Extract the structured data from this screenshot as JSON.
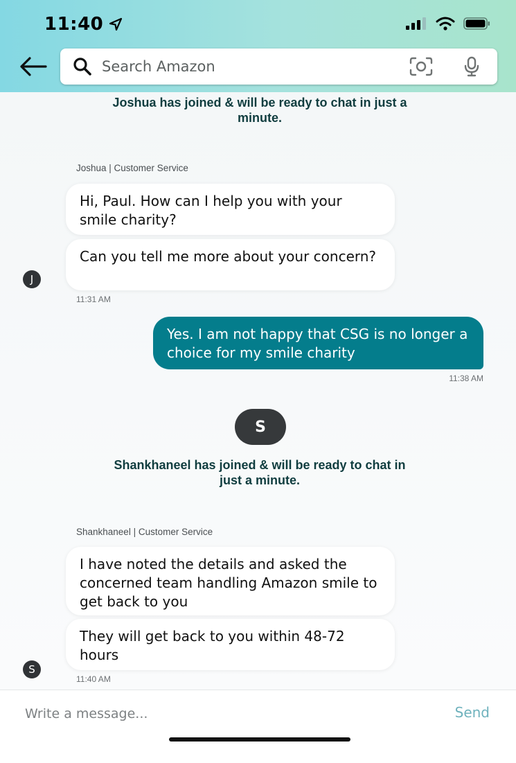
{
  "status_bar": {
    "time": "11:40",
    "icons": [
      "location-arrow-icon",
      "signal-icon",
      "wifi-icon",
      "battery-icon"
    ]
  },
  "header": {
    "search_placeholder": "Search Amazon",
    "icons": [
      "back-arrow-icon",
      "search-icon",
      "camera-lens-icon",
      "microphone-icon"
    ]
  },
  "chat": {
    "joshua_joined": "Joshua has joined & will be ready to chat in just a minute.",
    "joshua_label": "Joshua | Customer Service",
    "joshua_avatar": "J",
    "joshua_messages": [
      "Hi, Paul. How can I help you with your smile charity?",
      "Can you tell me more about your concern?"
    ],
    "joshua_time": "11:31 AM",
    "user_message": "Yes. I am not happy that CSG is no longer a choice for my smile charity",
    "user_time": "11:38 AM",
    "shankhaneel_badge": "S",
    "shankhaneel_joined": "Shankhaneel has joined & will be ready to chat in just a minute.",
    "shankhaneel_label": "Shankhaneel | Customer Service",
    "shankhaneel_avatar": "S",
    "shankhaneel_messages": [
      "I have noted the details and asked the concerned team handling Amazon smile to get back to you",
      "They will get back to you within 48-72 hours"
    ],
    "shankhaneel_time": "11:40 AM"
  },
  "composer": {
    "placeholder": "Write a message...",
    "send_label": "Send"
  },
  "colors": {
    "header_start": "#84d8e3",
    "header_end": "#a8e4cc",
    "outgoing_bubble": "#047d8c",
    "send_text": "#6fb2bd",
    "system_text": "#103d3f"
  }
}
